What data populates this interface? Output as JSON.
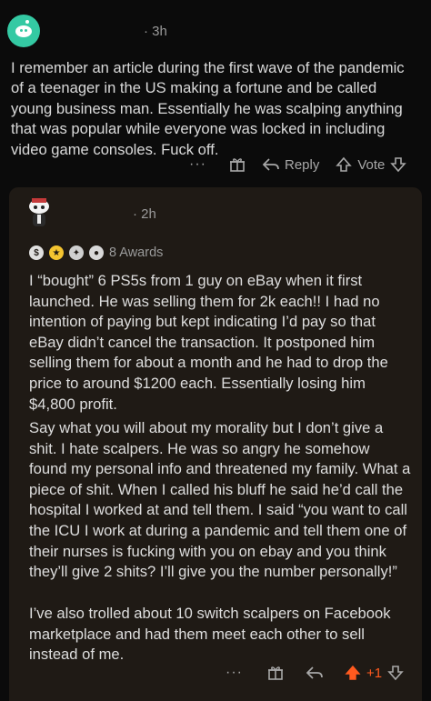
{
  "comment": {
    "time": "· 3h",
    "body": "I remember an article during the first wave of the pandemic of a teenager in the US making a fortune and be called young business man. Essentially he was scalping anything that was popular while everyone was locked in including video game consoles. Fuck off.",
    "actions": {
      "more": "···",
      "reply": "Reply",
      "vote": "Vote"
    }
  },
  "reply": {
    "time": "· 2h",
    "awards_label": "8 Awards",
    "paragraphs": [
      "I “bought” 6 PS5s from 1 guy on eBay when it first launched. He was selling them for 2k each!! I had no intention of paying but kept indicating I’d pay so that eBay didn’t cancel the transaction. It postponed him selling them for about a month and he had to drop the price to around $1200 each. Essentially losing him $4,800 profit.",
      "Say what you will about my morality but I don’t give a shit. I hate scalpers. He was so angry he somehow found my personal info and threatened my family. What a piece of shit. When I called his bluff he said he’d call the hospital I worked at and tell them. I said “you want to call the ICU I work at during a pandemic and tell them one of their nurses is fucking with you on ebay and you think they’ll give 2 shits? I’ll give you the number personally!”",
      "I’ve also trolled about 10 switch scalpers on Facebook marketplace and had them meet each other to sell instead of me."
    ],
    "actions": {
      "more": "···",
      "vote_count": "+1"
    }
  },
  "colors": {
    "background": "#0b0b0b",
    "card": "#1f1a15",
    "accent": "#ff5a1f",
    "avatar": "#34c9a3"
  },
  "icons": [
    "snoo-avatar-icon",
    "award-icon",
    "add-award-icon",
    "reply-arrow-icon",
    "upvote-icon",
    "downvote-icon"
  ]
}
